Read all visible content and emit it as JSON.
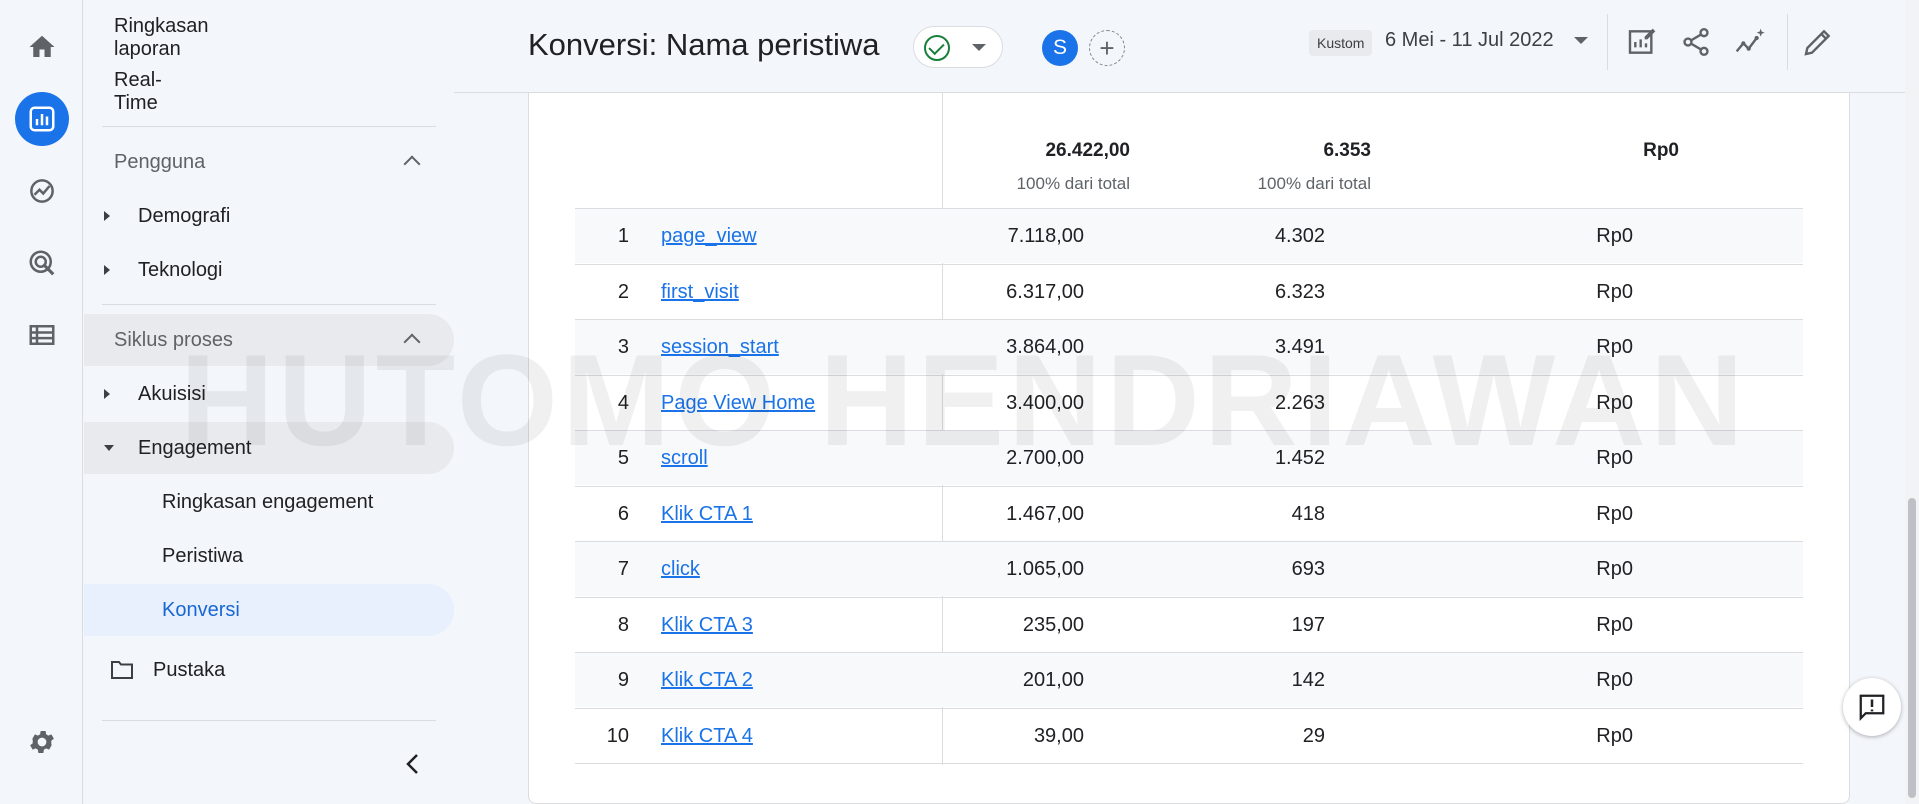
{
  "rail": {
    "items": [
      {
        "name": "home-icon",
        "active": false
      },
      {
        "name": "reports-icon",
        "active": true
      },
      {
        "name": "explore-icon",
        "active": false
      },
      {
        "name": "advertising-icon",
        "active": false
      },
      {
        "name": "configure-icon",
        "active": false
      }
    ],
    "settings_icon": "gear-icon"
  },
  "sidenav": {
    "ringkasan_laporan": "Ringkasan laporan",
    "realtime": "Real-Time",
    "section_pengguna": "Pengguna",
    "demografi": "Demografi",
    "teknologi": "Teknologi",
    "section_siklus": "Siklus proses",
    "akuisisi": "Akuisisi",
    "engagement": "Engagement",
    "ringkasan_engagement": "Ringkasan engagement",
    "peristiwa": "Peristiwa",
    "konversi": "Konversi",
    "pustaka": "Pustaka"
  },
  "header": {
    "title": "Konversi: Nama peristiwa",
    "avatar_letter": "S",
    "add_compare": "+",
    "date_badge": "Kustom",
    "date_range": "6 Mei - 11 Jul 2022"
  },
  "table": {
    "totals": [
      {
        "value": "26.422,00",
        "sub": "100% dari total"
      },
      {
        "value": "6.353",
        "sub": "100% dari total"
      },
      {
        "value": "Rp0",
        "sub": ""
      }
    ],
    "rows": [
      {
        "rank": "1",
        "event": "page_view",
        "conversions": "7.118,00",
        "users": "4.302",
        "revenue": "Rp0"
      },
      {
        "rank": "2",
        "event": "first_visit",
        "conversions": "6.317,00",
        "users": "6.323",
        "revenue": "Rp0"
      },
      {
        "rank": "3",
        "event": "session_start",
        "conversions": "3.864,00",
        "users": "3.491",
        "revenue": "Rp0"
      },
      {
        "rank": "4",
        "event": "Page View Home",
        "conversions": "3.400,00",
        "users": "2.263",
        "revenue": "Rp0"
      },
      {
        "rank": "5",
        "event": "scroll",
        "conversions": "2.700,00",
        "users": "1.452",
        "revenue": "Rp0"
      },
      {
        "rank": "6",
        "event": "Klik CTA 1",
        "conversions": "1.467,00",
        "users": "418",
        "revenue": "Rp0"
      },
      {
        "rank": "7",
        "event": "click",
        "conversions": "1.065,00",
        "users": "693",
        "revenue": "Rp0"
      },
      {
        "rank": "8",
        "event": "Klik CTA 3",
        "conversions": "235,00",
        "users": "197",
        "revenue": "Rp0"
      },
      {
        "rank": "9",
        "event": "Klik CTA 2",
        "conversions": "201,00",
        "users": "142",
        "revenue": "Rp0"
      },
      {
        "rank": "10",
        "event": "Klik CTA 4",
        "conversions": "39,00",
        "users": "29",
        "revenue": "Rp0"
      }
    ]
  },
  "watermark": "HUTOMO HENDRIAWAN",
  "colors": {
    "accent": "#1a73e8",
    "success": "#188038",
    "link": "#1a73e8"
  }
}
